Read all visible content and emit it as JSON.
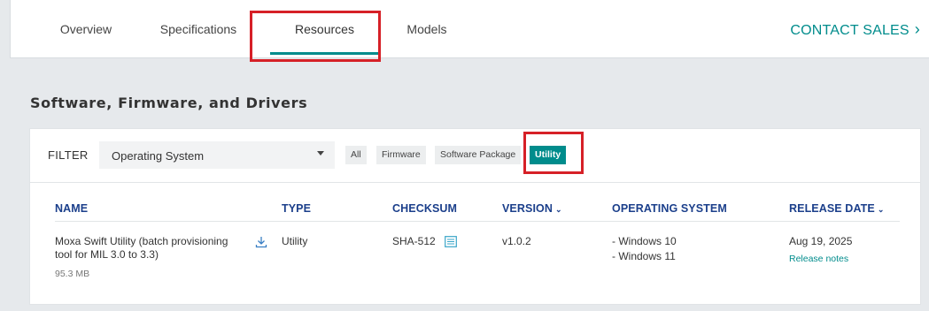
{
  "nav": {
    "tabs": [
      "Overview",
      "Specifications",
      "Resources",
      "Models"
    ],
    "active_tab": "Resources",
    "contact_label": "CONTACT SALES",
    "contact_chevron": "›"
  },
  "section": {
    "title": "Software, Firmware, and Drivers"
  },
  "filter": {
    "label": "FILTER",
    "select_value": "Operating System",
    "chips": [
      "All",
      "Firmware",
      "Software Package",
      "Utility"
    ],
    "active_chip": "Utility"
  },
  "table": {
    "headers": {
      "name": "NAME",
      "type": "TYPE",
      "checksum": "CHECKSUM",
      "version": "VERSION",
      "os": "OPERATING SYSTEM",
      "release_date": "RELEASE DATE"
    },
    "sort_arrow": "⌄",
    "rows": [
      {
        "name_line1": "Moxa Swift Utility (batch provisioning",
        "name_line2": "tool for MIL 3.0 to 3.3)",
        "size": "95.3 MB",
        "type": "Utility",
        "checksum": "SHA-512",
        "version": "v1.0.2",
        "os": [
          "- Windows 10",
          "- Windows 11"
        ],
        "release_date": "Aug 19, 2025",
        "release_notes": "Release notes"
      }
    ]
  },
  "colors": {
    "accent": "#008c8c",
    "header_text": "#1b3f8b",
    "highlight": "#d62027"
  }
}
